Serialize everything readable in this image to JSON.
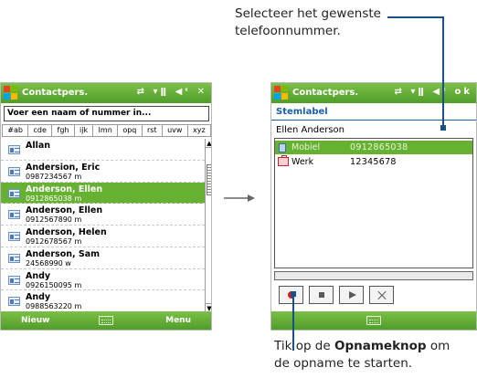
{
  "left_screen": {
    "title": "Contactpers.",
    "search_placeholder": "Voer een naam of nummer in...",
    "alpha_tabs": [
      "#ab",
      "cde",
      "fgh",
      "ijk",
      "lmn",
      "opq",
      "rst",
      "uvw",
      "xyz"
    ],
    "contacts": [
      {
        "name": "Allan",
        "sub": ""
      },
      {
        "name": "Andersion, Eric",
        "sub": "0987234567   m"
      },
      {
        "name": "Anderson, Ellen",
        "sub": "0912865038   m"
      },
      {
        "name": "Anderson, Ellen",
        "sub": "0912567890   m"
      },
      {
        "name": "Anderson, Helen",
        "sub": "0912678567   m"
      },
      {
        "name": "Anderson, Sam",
        "sub": "24568990   w"
      },
      {
        "name": "Andy",
        "sub": "0926150095   m"
      },
      {
        "name": "Andy",
        "sub": "0988563220   m"
      }
    ],
    "selected_index": 2,
    "softkey_left": "Nieuw",
    "softkey_right": "Menu"
  },
  "right_screen": {
    "title": "Contactpers.",
    "ok_label": "ok",
    "header": "Stemlabel",
    "contact_name": "Ellen Anderson",
    "numbers": [
      {
        "label": "Mobiel",
        "number": "0912865038",
        "selected": true
      },
      {
        "label": "Werk",
        "number": "12345678",
        "selected": false
      }
    ]
  },
  "callouts": {
    "top_line1": "Selecteer het gewenste",
    "top_line2": "telefoonnummer.",
    "bottom_line1_pre": "Tik op de ",
    "bottom_line1_bold": "Opnameknop",
    "bottom_line1_post": " om",
    "bottom_line2": "de opname te starten."
  },
  "colors": {
    "accent_green": "#66b032",
    "callout_blue": "#1a4f8c",
    "header_blue": "#1a5fa8"
  }
}
